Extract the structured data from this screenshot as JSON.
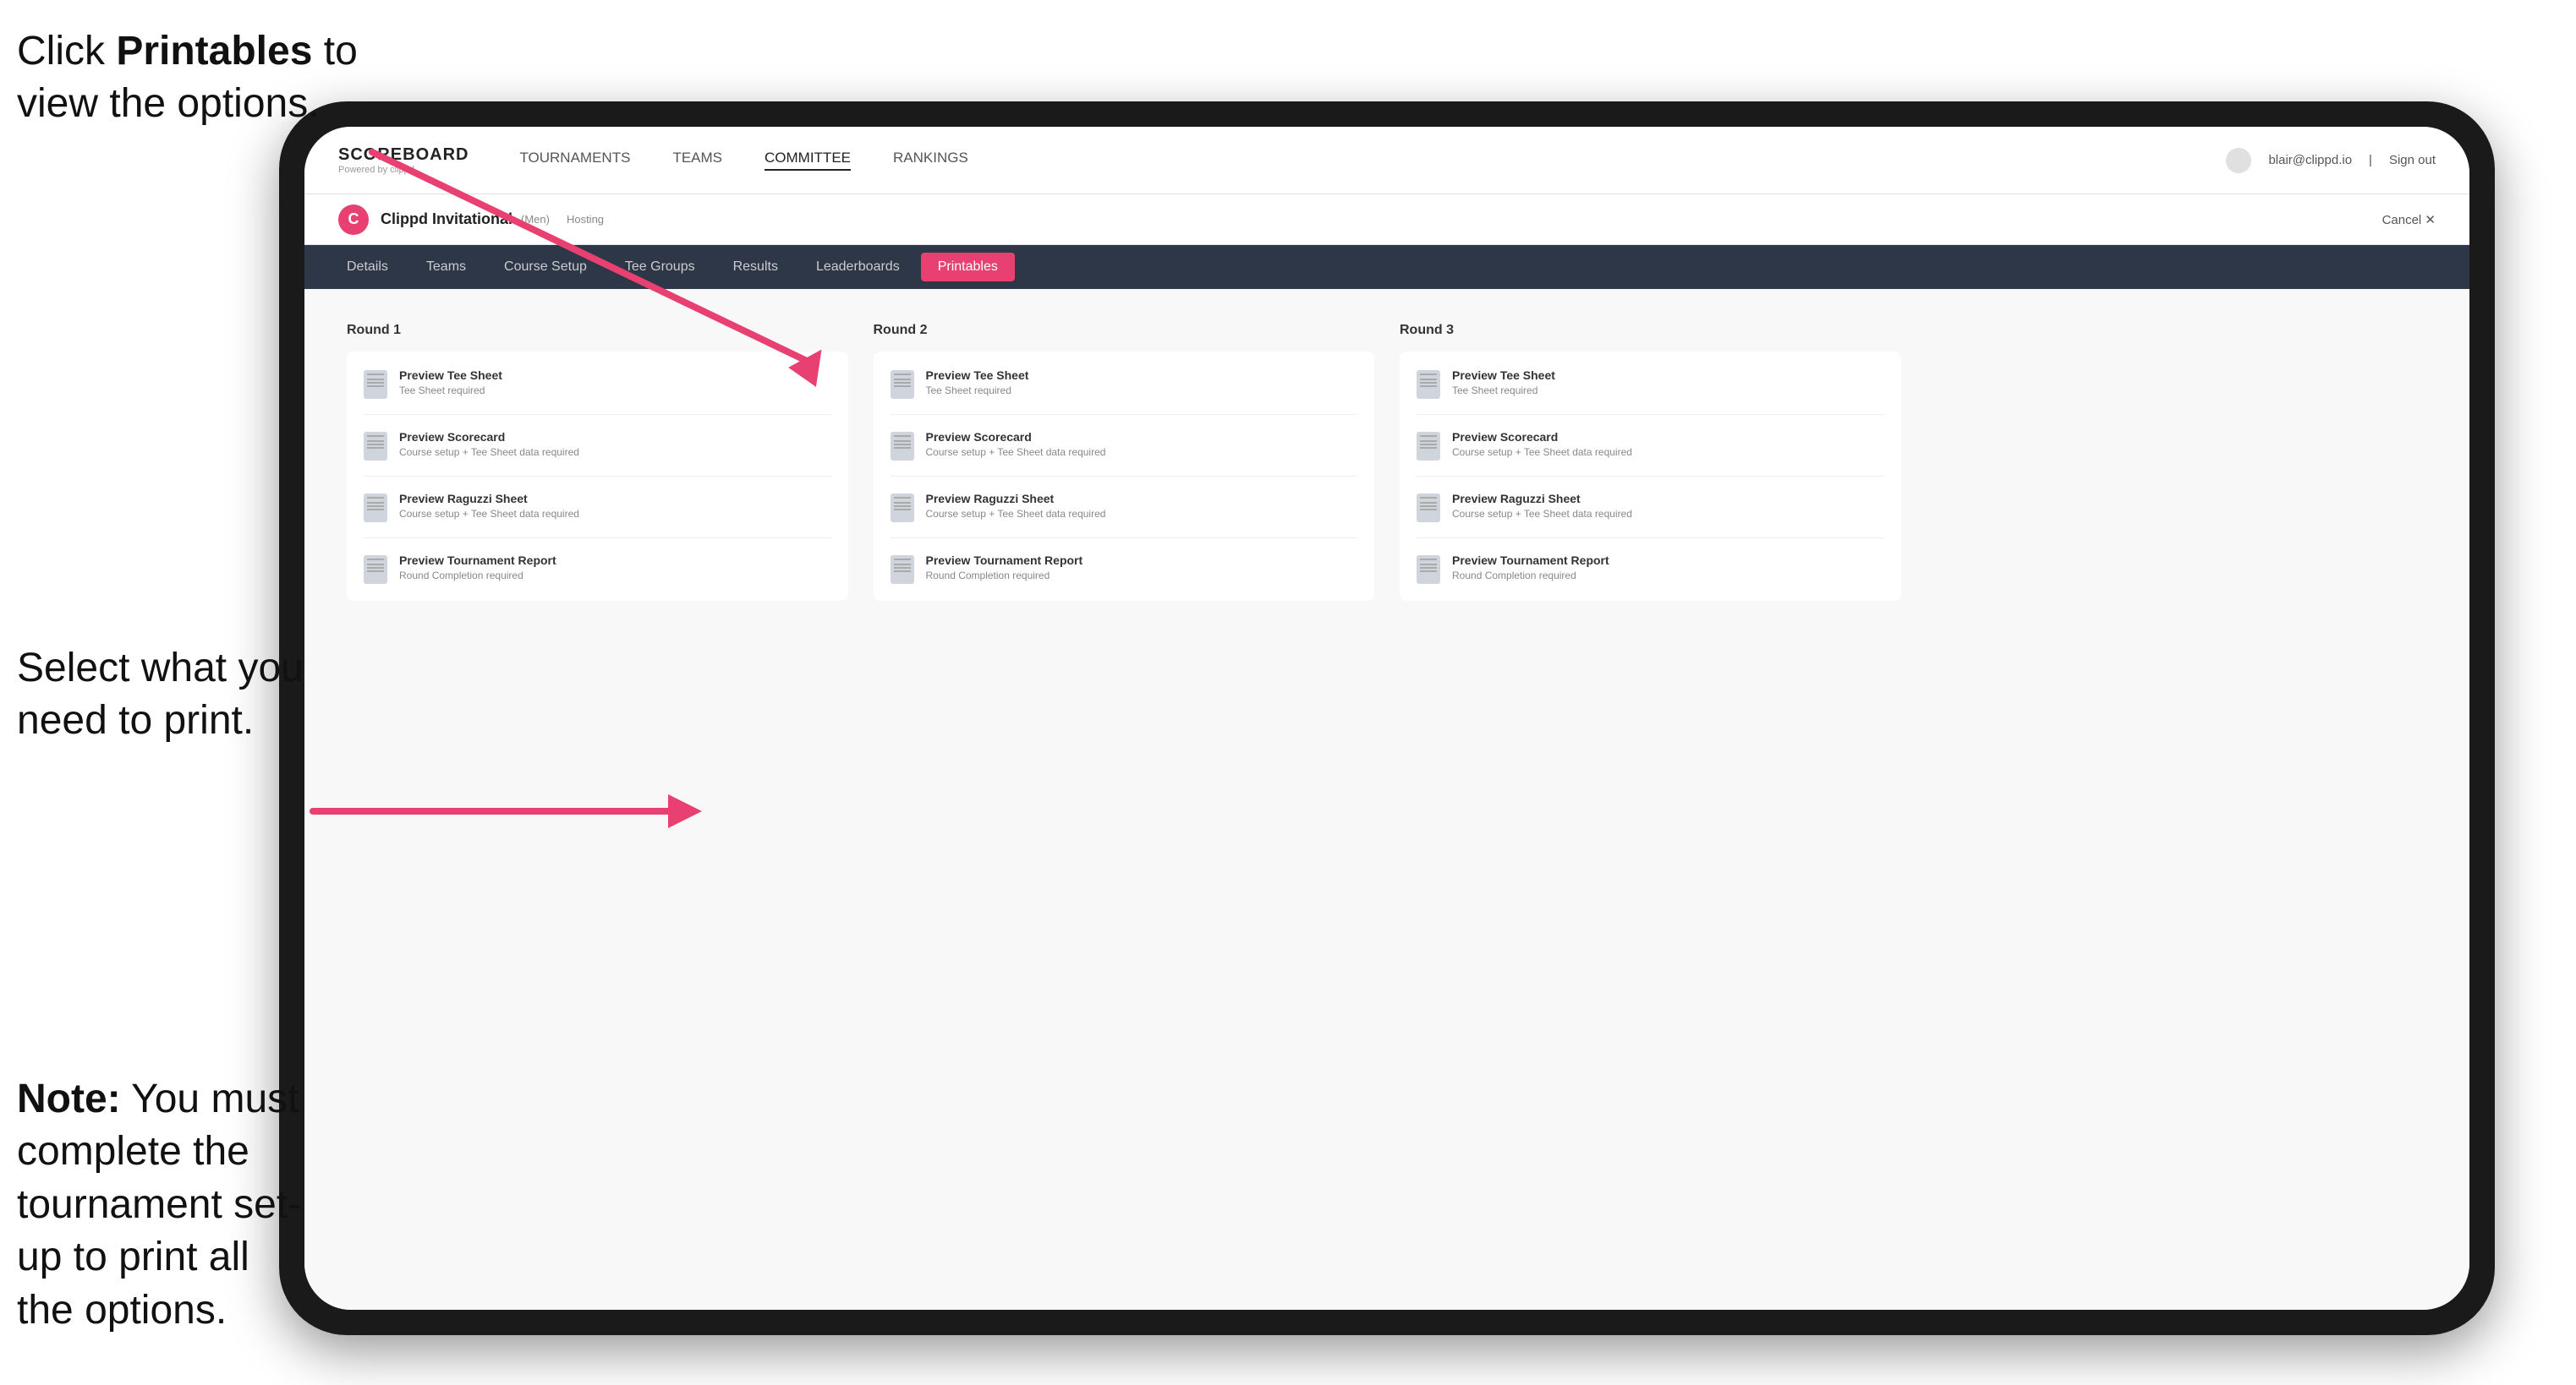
{
  "instructions": {
    "top": {
      "line1": "Click ",
      "bold": "Printables",
      "line2": " to",
      "line3": "view the options."
    },
    "mid": {
      "text": "Select what you need to print."
    },
    "bottom": {
      "bold": "Note:",
      "text": " You must complete the tournament set-up to print all the options."
    }
  },
  "topnav": {
    "logo_title": "SCOREBOARD",
    "logo_sub": "Powered by clippd",
    "links": [
      {
        "label": "TOURNAMENTS",
        "active": false
      },
      {
        "label": "TEAMS",
        "active": false
      },
      {
        "label": "COMMITTEE",
        "active": true
      },
      {
        "label": "RANKINGS",
        "active": false
      }
    ],
    "user_email": "blair@clippd.io",
    "sign_out": "Sign out"
  },
  "tournament": {
    "logo_letter": "C",
    "name": "Clippd Invitational",
    "badge": "(Men)",
    "status": "Hosting",
    "cancel": "Cancel ✕"
  },
  "subtabs": [
    {
      "label": "Details",
      "active": false
    },
    {
      "label": "Teams",
      "active": false
    },
    {
      "label": "Course Setup",
      "active": false
    },
    {
      "label": "Tee Groups",
      "active": false
    },
    {
      "label": "Results",
      "active": false
    },
    {
      "label": "Leaderboards",
      "active": false
    },
    {
      "label": "Printables",
      "active": true
    }
  ],
  "rounds": [
    {
      "title": "Round 1",
      "items": [
        {
          "title": "Preview Tee Sheet",
          "sub": "Tee Sheet required"
        },
        {
          "title": "Preview Scorecard",
          "sub": "Course setup + Tee Sheet data required"
        },
        {
          "title": "Preview Raguzzi Sheet",
          "sub": "Course setup + Tee Sheet data required"
        },
        {
          "title": "Preview Tournament Report",
          "sub": "Round Completion required"
        }
      ]
    },
    {
      "title": "Round 2",
      "items": [
        {
          "title": "Preview Tee Sheet",
          "sub": "Tee Sheet required"
        },
        {
          "title": "Preview Scorecard",
          "sub": "Course setup + Tee Sheet data required"
        },
        {
          "title": "Preview Raguzzi Sheet",
          "sub": "Course setup + Tee Sheet data required"
        },
        {
          "title": "Preview Tournament Report",
          "sub": "Round Completion required"
        }
      ]
    },
    {
      "title": "Round 3",
      "items": [
        {
          "title": "Preview Tee Sheet",
          "sub": "Tee Sheet required"
        },
        {
          "title": "Preview Scorecard",
          "sub": "Course setup + Tee Sheet data required"
        },
        {
          "title": "Preview Raguzzi Sheet",
          "sub": "Course setup + Tee Sheet data required"
        },
        {
          "title": "Preview Tournament Report",
          "sub": "Round Completion required"
        }
      ]
    }
  ]
}
